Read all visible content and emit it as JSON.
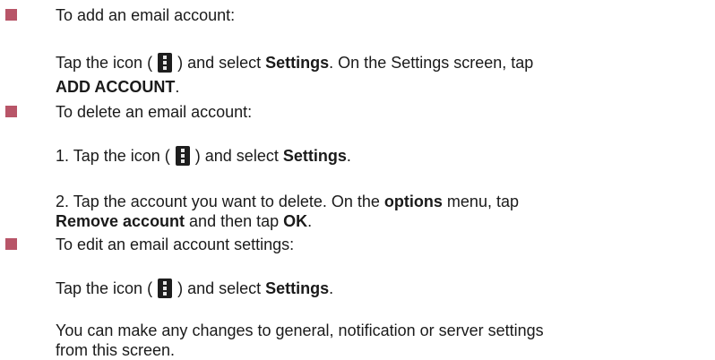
{
  "colors": {
    "bullet": "#b85568",
    "text": "#1a1a1a",
    "icon_bg": "#1e1e1e"
  },
  "icons": {
    "menu": "overflow-menu-icon"
  },
  "sections": [
    {
      "heading": "To add an email account:",
      "para1": {
        "line1": {
          "pre": "Tap the icon (",
          "mid": ") and select ",
          "bold": "Settings",
          "post": ". On the Settings screen, tap"
        },
        "line2": {
          "bold": "ADD ACCOUNT",
          "post": "."
        }
      }
    },
    {
      "heading": "To delete an email account:",
      "step1": {
        "pre": "1. Tap the icon (",
        "mid": ") and select ",
        "bold": "Settings",
        "post": "."
      },
      "step2": {
        "line1": {
          "pre": "2. Tap the account you want to delete. On the ",
          "bold": "options",
          "post": " menu, tap"
        },
        "line2": {
          "bold1": "Remove account",
          "mid": " and then tap ",
          "bold2": "OK",
          "post": "."
        }
      }
    },
    {
      "heading": "To edit an email account settings:",
      "para1": {
        "pre": "Tap the icon (",
        "mid": ") and select ",
        "bold": "Settings",
        "post": "."
      },
      "para2": {
        "line1": "You can make any changes to general, notification or server settings",
        "line2": "from this screen."
      }
    }
  ]
}
